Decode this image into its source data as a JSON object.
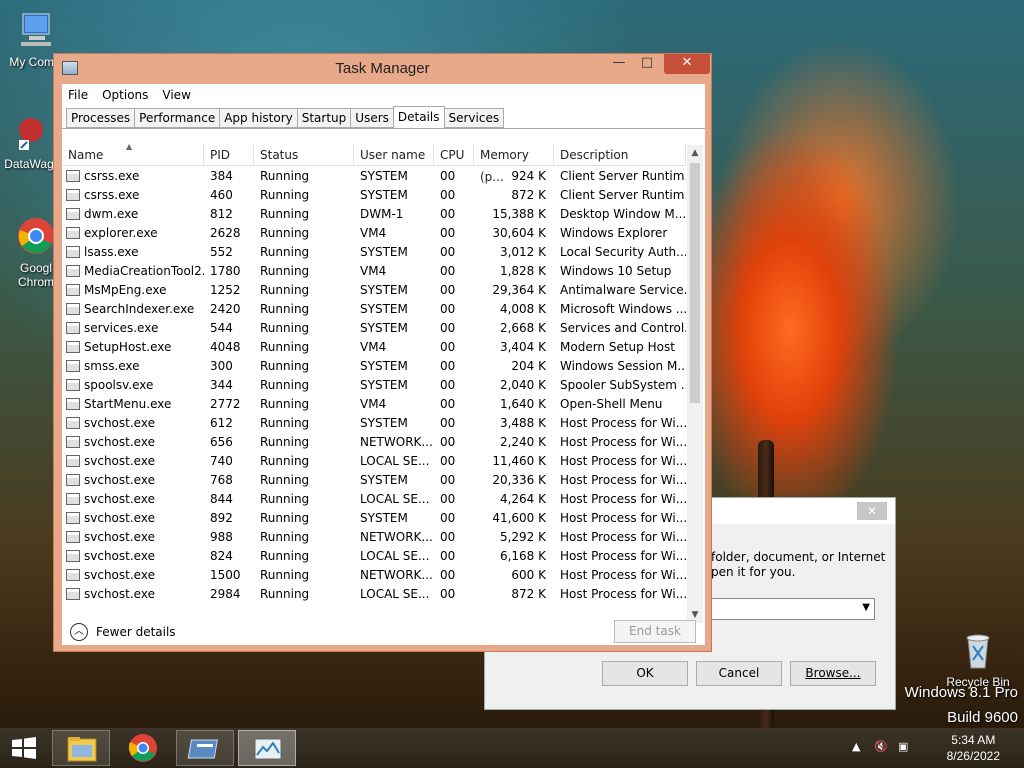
{
  "desktop": {
    "icons": [
      {
        "label": "My Comp",
        "icon": "computer-icon"
      },
      {
        "label": "DataWag",
        "icon": "datawag-icon"
      },
      {
        "label": "Googl Chrom",
        "icon": "chrome-icon"
      },
      {
        "label": "Recycle Bin",
        "icon": "recycle-bin-icon"
      }
    ],
    "brand_line1": "Windows 8.1 Pro",
    "brand_line2": "Build 9600"
  },
  "run_dialog": {
    "description_line1": "folder, document, or Internet",
    "description_line2": "pen it for you.",
    "close_glyph": "✕",
    "ok_label": "OK",
    "cancel_label": "Cancel",
    "browse_label": "Browse..."
  },
  "task_manager": {
    "title": "Task Manager",
    "menu": [
      "File",
      "Options",
      "View"
    ],
    "tabs": [
      "Processes",
      "Performance",
      "App history",
      "Startup",
      "Users",
      "Details",
      "Services"
    ],
    "active_tab": "Details",
    "columns": [
      "Name",
      "PID",
      "Status",
      "User name",
      "CPU",
      "Memory (p...",
      "Description"
    ],
    "rows": [
      [
        "csrss.exe",
        "384",
        "Running",
        "SYSTEM",
        "00",
        "924 K",
        "Client Server Runtim..."
      ],
      [
        "csrss.exe",
        "460",
        "Running",
        "SYSTEM",
        "00",
        "872 K",
        "Client Server Runtim..."
      ],
      [
        "dwm.exe",
        "812",
        "Running",
        "DWM-1",
        "00",
        "15,388 K",
        "Desktop Window M..."
      ],
      [
        "explorer.exe",
        "2628",
        "Running",
        "VM4",
        "00",
        "30,604 K",
        "Windows Explorer"
      ],
      [
        "lsass.exe",
        "552",
        "Running",
        "SYSTEM",
        "00",
        "3,012 K",
        "Local Security Auth..."
      ],
      [
        "MediaCreationTool2...",
        "1780",
        "Running",
        "VM4",
        "00",
        "1,828 K",
        "Windows 10 Setup"
      ],
      [
        "MsMpEng.exe",
        "1252",
        "Running",
        "SYSTEM",
        "00",
        "29,364 K",
        "Antimalware Service..."
      ],
      [
        "SearchIndexer.exe",
        "2420",
        "Running",
        "SYSTEM",
        "00",
        "4,008 K",
        "Microsoft Windows ..."
      ],
      [
        "services.exe",
        "544",
        "Running",
        "SYSTEM",
        "00",
        "2,668 K",
        "Services and Control..."
      ],
      [
        "SetupHost.exe",
        "4048",
        "Running",
        "VM4",
        "00",
        "3,404 K",
        "Modern Setup Host"
      ],
      [
        "smss.exe",
        "300",
        "Running",
        "SYSTEM",
        "00",
        "204 K",
        "Windows Session M..."
      ],
      [
        "spoolsv.exe",
        "344",
        "Running",
        "SYSTEM",
        "00",
        "2,040 K",
        "Spooler SubSystem ..."
      ],
      [
        "StartMenu.exe",
        "2772",
        "Running",
        "VM4",
        "00",
        "1,640 K",
        "Open-Shell Menu"
      ],
      [
        "svchost.exe",
        "612",
        "Running",
        "SYSTEM",
        "00",
        "3,488 K",
        "Host Process for Wi..."
      ],
      [
        "svchost.exe",
        "656",
        "Running",
        "NETWORK...",
        "00",
        "2,240 K",
        "Host Process for Wi..."
      ],
      [
        "svchost.exe",
        "740",
        "Running",
        "LOCAL SE...",
        "00",
        "11,460 K",
        "Host Process for Wi..."
      ],
      [
        "svchost.exe",
        "768",
        "Running",
        "SYSTEM",
        "00",
        "20,336 K",
        "Host Process for Wi..."
      ],
      [
        "svchost.exe",
        "844",
        "Running",
        "LOCAL SE...",
        "00",
        "4,264 K",
        "Host Process for Wi..."
      ],
      [
        "svchost.exe",
        "892",
        "Running",
        "SYSTEM",
        "00",
        "41,600 K",
        "Host Process for Wi..."
      ],
      [
        "svchost.exe",
        "988",
        "Running",
        "NETWORK...",
        "00",
        "5,292 K",
        "Host Process for Wi..."
      ],
      [
        "svchost.exe",
        "824",
        "Running",
        "LOCAL SE...",
        "00",
        "6,168 K",
        "Host Process for Wi..."
      ],
      [
        "svchost.exe",
        "1500",
        "Running",
        "NETWORK...",
        "00",
        "600 K",
        "Host Process for Wi..."
      ],
      [
        "svchost.exe",
        "2984",
        "Running",
        "LOCAL SE...",
        "00",
        "872 K",
        "Host Process for Wi..."
      ]
    ],
    "fewer_details_label": "Fewer details",
    "end_task_label": "End task",
    "caption_close": "✕",
    "caption_max": "□",
    "caption_min": "—"
  },
  "taskbar": {
    "time": "5:34 AM",
    "date": "8/26/2022",
    "items": [
      "start-icon",
      "file-explorer-icon",
      "chrome-icon",
      "run-icon",
      "task-manager-icon"
    ]
  }
}
